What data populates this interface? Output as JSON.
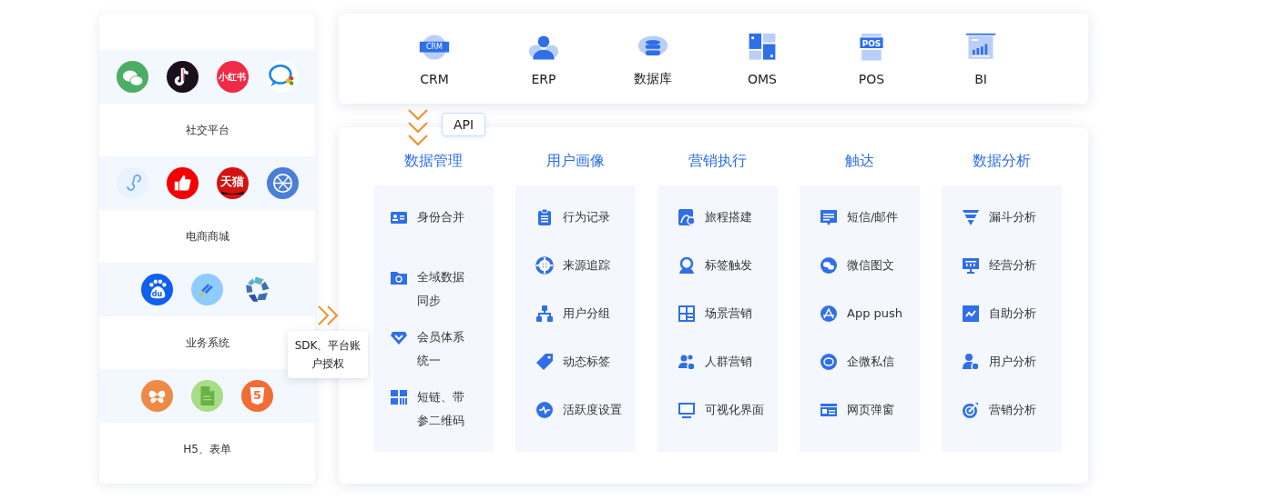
{
  "sources": [
    {
      "label": "社交平台",
      "icons": [
        {
          "kind": "wechat"
        },
        {
          "kind": "tiktok"
        },
        {
          "kind": "redbook",
          "text": "小红书"
        },
        {
          "kind": "wecom"
        }
      ]
    },
    {
      "label": "电商商城",
      "icons": [
        {
          "kind": "miniprogram"
        },
        {
          "kind": "thumb"
        },
        {
          "kind": "tmall",
          "text": "天猫"
        },
        {
          "kind": "globe"
        }
      ]
    },
    {
      "label": "业务系统",
      "icons": [
        {
          "kind": "baidu",
          "text": "du"
        },
        {
          "kind": "dingtalk"
        },
        {
          "kind": "blocks"
        }
      ]
    },
    {
      "label": "H5、表单",
      "icons": [
        {
          "kind": "leaf"
        },
        {
          "kind": "doc"
        },
        {
          "kind": "html5",
          "text": "5"
        }
      ]
    }
  ],
  "sdk_badge": "SDK、平台账户授权",
  "systems": [
    {
      "kind": "crm",
      "label": "CRM",
      "text": "CRM"
    },
    {
      "kind": "erp",
      "label": "ERP"
    },
    {
      "kind": "database",
      "label": "数据库"
    },
    {
      "kind": "oms",
      "label": "OMS"
    },
    {
      "kind": "pos",
      "label": "POS",
      "text": "POS"
    },
    {
      "kind": "bi",
      "label": "BI"
    }
  ],
  "api_badge": "API",
  "modules": [
    {
      "title": "数据管理",
      "items": [
        {
          "kind": "idcard",
          "label": "身份合并"
        },
        {
          "kind": "folder",
          "label": "全域数据同步"
        },
        {
          "kind": "diamond",
          "label": "会员体系统一"
        },
        {
          "kind": "qrcode",
          "label": "短链、带参二维码"
        }
      ]
    },
    {
      "title": "用户画像",
      "items": [
        {
          "kind": "clipboard",
          "label": "行为记录"
        },
        {
          "kind": "crosshair",
          "label": "来源追踪"
        },
        {
          "kind": "org",
          "label": "用户分组"
        },
        {
          "kind": "tag",
          "label": "动态标签"
        },
        {
          "kind": "pulse",
          "label": "活跃度设置"
        }
      ]
    },
    {
      "title": "营销执行",
      "items": [
        {
          "kind": "route",
          "label": "旅程搭建"
        },
        {
          "kind": "person",
          "label": "标签触发"
        },
        {
          "kind": "grid",
          "label": "场景营销"
        },
        {
          "kind": "group",
          "label": "人群营销"
        },
        {
          "kind": "monitor",
          "label": "可视化界面"
        }
      ]
    },
    {
      "title": "触达",
      "items": [
        {
          "kind": "message",
          "label": "短信/邮件"
        },
        {
          "kind": "chat",
          "label": "微信图文"
        },
        {
          "kind": "appstore",
          "label": "App push"
        },
        {
          "kind": "bubble",
          "label": "企微私信"
        },
        {
          "kind": "window",
          "label": "网页弹窗"
        }
      ]
    },
    {
      "title": "数据分析",
      "items": [
        {
          "kind": "funnel",
          "label": "漏斗分析"
        },
        {
          "kind": "board",
          "label": "经营分析"
        },
        {
          "kind": "linechart",
          "label": "自助分析"
        },
        {
          "kind": "userchart",
          "label": "用户分析"
        },
        {
          "kind": "dart",
          "label": "营销分析"
        }
      ]
    }
  ]
}
